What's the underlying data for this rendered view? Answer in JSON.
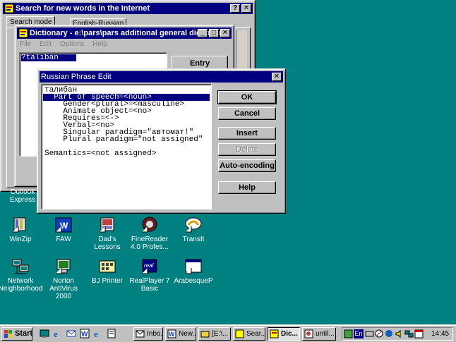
{
  "search_window": {
    "title": "Search for new words in the Internet",
    "tabs": [
      "Search mode",
      "English-Russian"
    ]
  },
  "dictionary_window": {
    "title": "Dictionary - e:\\pars\\pars additional general dictionary",
    "menu": [
      "File",
      "Edit",
      "Options",
      "Help"
    ],
    "search_value": "?taliban",
    "entry_button": "Entry"
  },
  "phrase_dialog": {
    "title": "Russian Phrase Edit",
    "lines": [
      "талибан",
      "  Part of speech=<noun>",
      "    Gender<plural>=<masculine>",
      "    Animate object=<no>",
      "    Requires=<->",
      "    Verbal=<no>",
      "    Singular paradigm=\"автомат!\"",
      "    Plural paradigm=\"not assigned\"",
      "",
      "Semantics=<not assigned>"
    ],
    "selected_index": 1,
    "buttons": {
      "ok": "OK",
      "cancel": "Cancel",
      "insert": "Insert",
      "delete": "Delete",
      "auto": "Auto-encoding",
      "help": "Help"
    }
  },
  "desktop_icons": [
    {
      "label": "Outlook Express",
      "icon": "outlook-express-icon"
    },
    {
      "label": "WinZip",
      "icon": "winzip-icon"
    },
    {
      "label": "FAW",
      "icon": "faw-icon"
    },
    {
      "label": "Dad's Lessons",
      "icon": "dads-lessons-icon"
    },
    {
      "label": "FineReader 4.0 Profes...",
      "icon": "finereader-icon"
    },
    {
      "label": "TransIt",
      "icon": "transit-icon"
    },
    {
      "label": "Network Neighborhood",
      "icon": "network-neighborhood-icon"
    },
    {
      "label": "Norton AntiVirus 2000",
      "icon": "norton-antivirus-icon"
    },
    {
      "label": "BJ Printer",
      "icon": "bj-printer-icon"
    },
    {
      "label": "RealPlayer 7 Basic",
      "icon": "realplayer-icon"
    },
    {
      "label": "ArabesqueP",
      "icon": "arabesque-icon"
    }
  ],
  "taskbar": {
    "start": "Start",
    "tasks": [
      "Inbo...",
      "New...",
      "[E:\\...",
      "Sear...",
      "Dic...",
      "until..."
    ],
    "active_task_index": 4,
    "language": "En",
    "clock": "14:45"
  },
  "colors": {
    "desktop": "#008080",
    "titlebar_active": "#000080",
    "titlebar_inactive": "#808080",
    "selection": "#000080"
  }
}
